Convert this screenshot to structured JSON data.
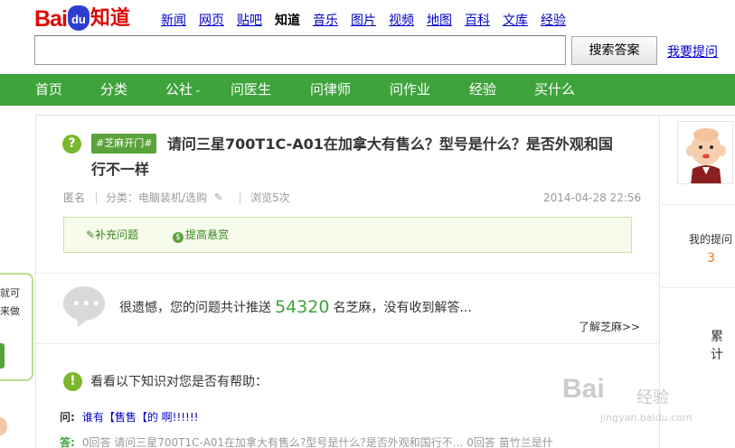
{
  "header": {
    "logo": {
      "bai": "Bai",
      "du": "du",
      "zhidao": "知道"
    },
    "nav": [
      "新闻",
      "网页",
      "贴吧",
      "知道",
      "音乐",
      "图片",
      "视频",
      "地图",
      "百科",
      "文库",
      "经验"
    ],
    "search": {
      "value": "",
      "button_label": "搜索答案"
    },
    "ask_link": "我要提问"
  },
  "greenbar": {
    "items": [
      "首页",
      "分类",
      "公社",
      "问医生",
      "问律师",
      "问作业",
      "经验",
      "买什么"
    ]
  },
  "question": {
    "tag": "#芝麻开门#",
    "title_line1": "请问三星700T1C-A01在加拿大有售么？型号是什么？是否外观和国",
    "title_line2": "行不一样",
    "author": "匿名",
    "category": "分类：电脑装机/选购",
    "views": "浏览5次",
    "date": "2014-04-28 22:56",
    "actions": {
      "supplement": "补充问题",
      "reward": "提高悬赏"
    }
  },
  "push_notice": {
    "prefix": "很遗憾，您的问题共计推送",
    "count": "54320",
    "suffix": "名芝麻，没有收到解答...",
    "learn_more": "了解芝麻>>"
  },
  "related": {
    "heading": "看看以下知识对您是否有帮助：",
    "q_label": "问:",
    "q_text": "谁有【售售【的 啊!!!!!!",
    "a_label": "答:",
    "a_text": "0回答 请问三星700T1C-A01在加拿大有售么?型号是什么?是否外观和国行不...",
    "a_meta": "0回答 苗竹兰是什"
  },
  "sidebar": {
    "my_questions_label": "我的提问",
    "my_questions_count": "3",
    "leiji": "累计"
  },
  "left_widget": {
    "line1": "就可",
    "line2": "来做"
  },
  "watermark": {
    "brand": "Bai",
    "jingyan": "经验",
    "url": "jingyan.baidu.com"
  },
  "colors": {
    "brand_red": "#e10601",
    "green": "#3fa33c",
    "link_blue": "#0000cc"
  }
}
